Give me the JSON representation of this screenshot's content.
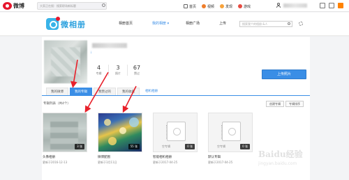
{
  "topbar": {
    "logo_text": "微博",
    "search_placeholder": "大家正在搜：搜索职场新标题",
    "nav": [
      {
        "label": "首页",
        "icon": "home-icon"
      },
      {
        "label": "视频",
        "icon": "video-icon"
      },
      {
        "label": "发现",
        "icon": "discover-icon"
      },
      {
        "label": "游戏",
        "icon": "game-icon"
      }
    ]
  },
  "album_header": {
    "logo_text": "微相册",
    "nav": [
      {
        "label": "相册首页",
        "active": false
      },
      {
        "label": "我的相册 ▾",
        "active": true
      },
      {
        "label": "相册广场",
        "active": false
      },
      {
        "label": "上传",
        "active": false
      }
    ],
    "search_placeholder": "搜索我个的相册 &人"
  },
  "profile": {
    "user_tag": "i",
    "stats": [
      {
        "value": "4",
        "label": "专辑"
      },
      {
        "value": "3",
        "label": "照片"
      },
      {
        "value": "67",
        "label": "赞过"
      }
    ],
    "upload_label": "上传照片"
  },
  "tabs": [
    {
      "label": "我的微博",
      "state": "normal"
    },
    {
      "label": "我的专辑",
      "state": "active"
    },
    {
      "label": "我赞过的",
      "state": "normal"
    },
    {
      "label": "我的收藏",
      "state": "normal"
    },
    {
      "label": "相机相册",
      "state": "plain"
    }
  ],
  "list": {
    "title": "专辑列表（共4个）",
    "create_label": "创建专辑",
    "sort_label": "专辑排序"
  },
  "albums": [
    {
      "name": "头像相册",
      "count": "3 张",
      "date": "更新于2016-12-13",
      "thumb": "blurry"
    },
    {
      "name": "微博配图",
      "count": "55 张",
      "date": "更新于3月11日",
      "thumb": "art"
    },
    {
      "name": "智能相机相册",
      "count": "0 张",
      "date": "更新于2017-04-25",
      "thumb": "empty",
      "empty_label": "空专辑"
    },
    {
      "name": "默认专辑",
      "count": "0 张",
      "date": "更新于2017-04-25",
      "thumb": "empty",
      "empty_label": "空专辑"
    }
  ],
  "watermark": {
    "big": "Baidu经验",
    "small": "jingyan.baidu.com"
  },
  "colors": {
    "accent": "#3a8ee6",
    "weibo_red": "#e6162d",
    "arrow_red": "#e8202a"
  }
}
